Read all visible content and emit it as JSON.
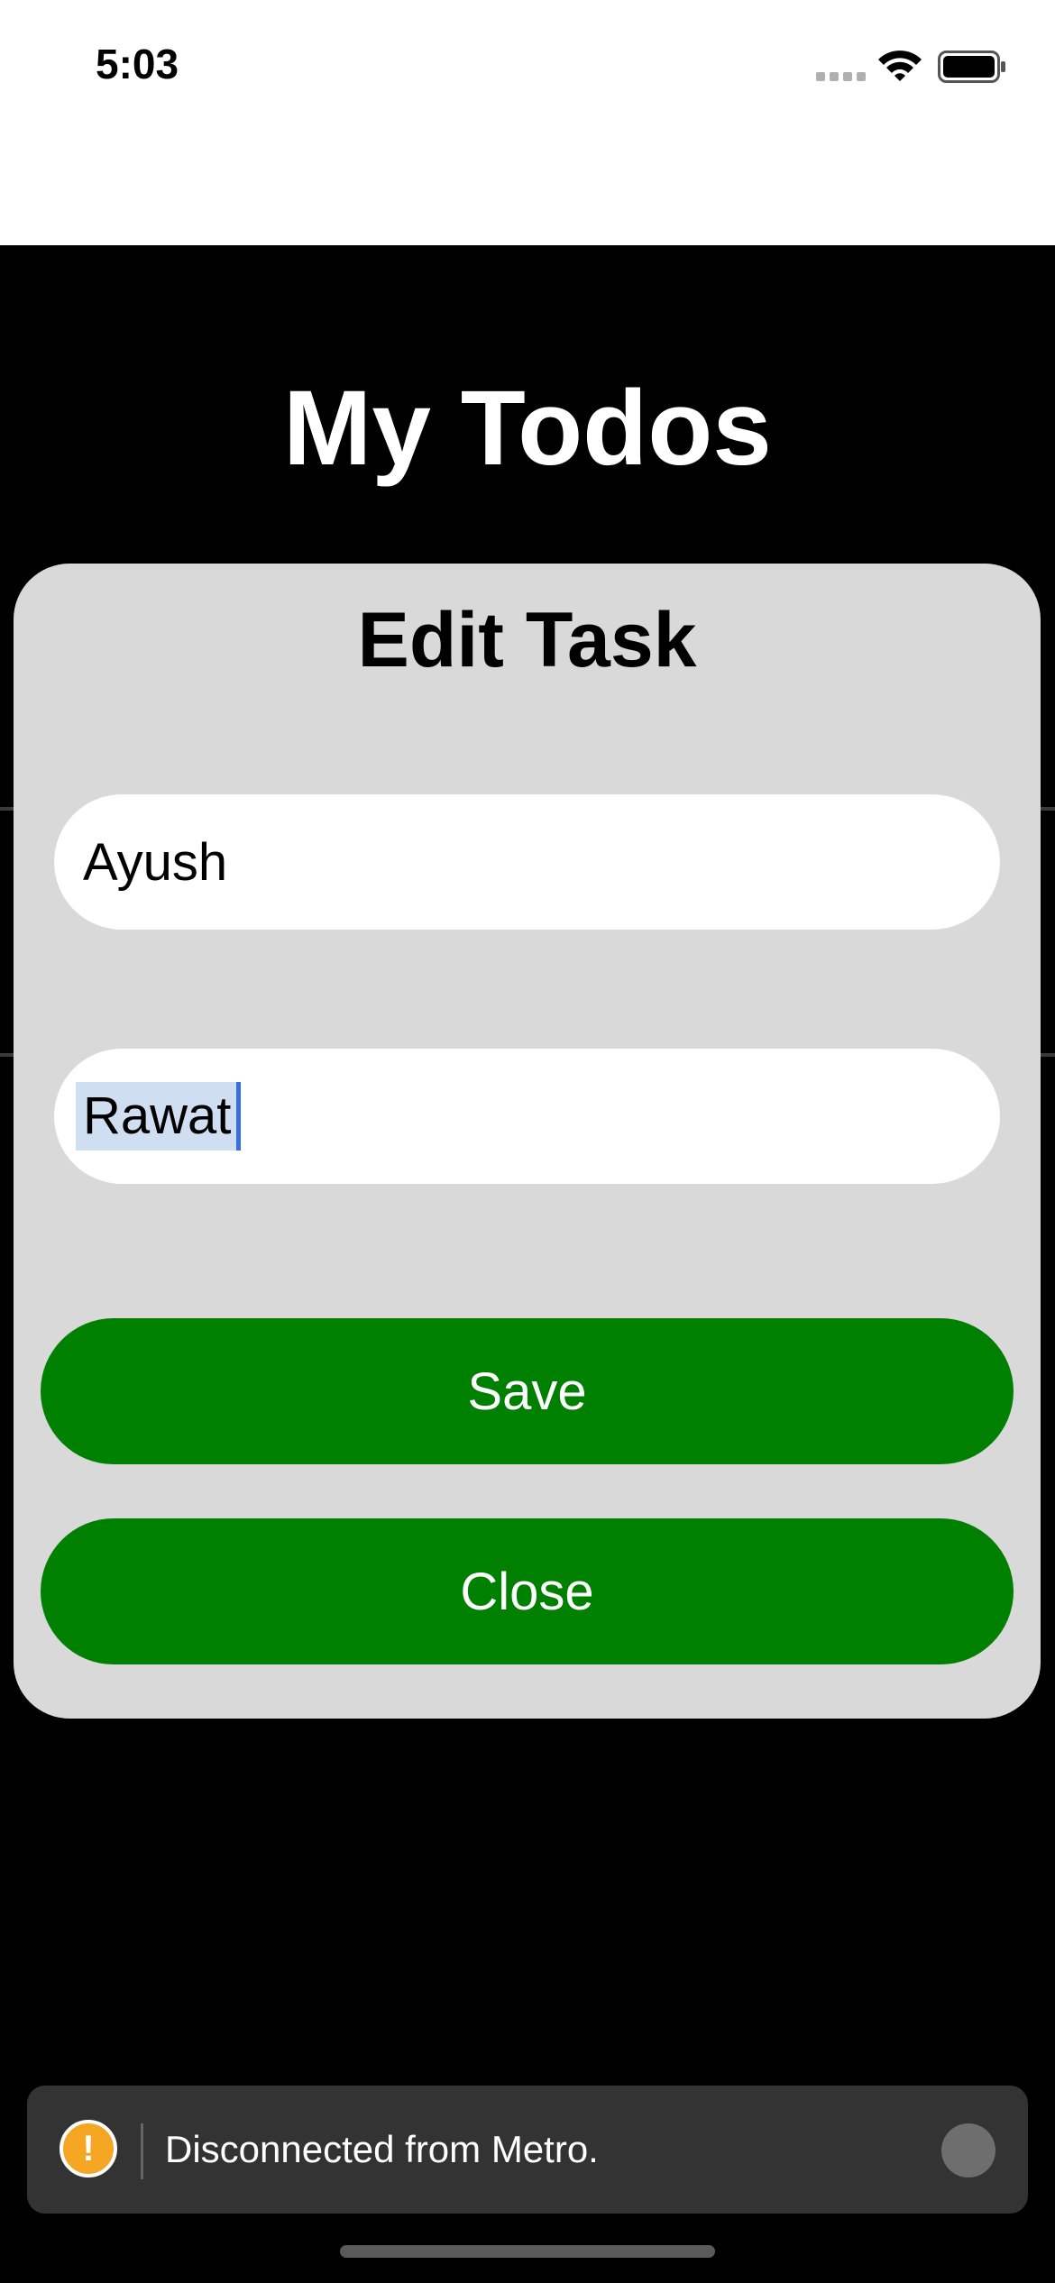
{
  "status_bar": {
    "time": "5:03",
    "icons": [
      "signal-icon",
      "wifi-icon",
      "battery-icon"
    ]
  },
  "app": {
    "title": "My Todos"
  },
  "modal": {
    "title": "Edit Task",
    "fields": [
      {
        "value": "Ayush"
      },
      {
        "value": "Rawat",
        "selected": true
      }
    ],
    "save_label": "Save",
    "close_label": "Close"
  },
  "toast": {
    "message": "Disconnected from Metro.",
    "icon": "warning-icon"
  },
  "colors": {
    "background": "#000000",
    "modal_background": "#d9d9d9",
    "button_green": "#008000",
    "toast_background": "#333333",
    "warning": "#f5a623"
  }
}
